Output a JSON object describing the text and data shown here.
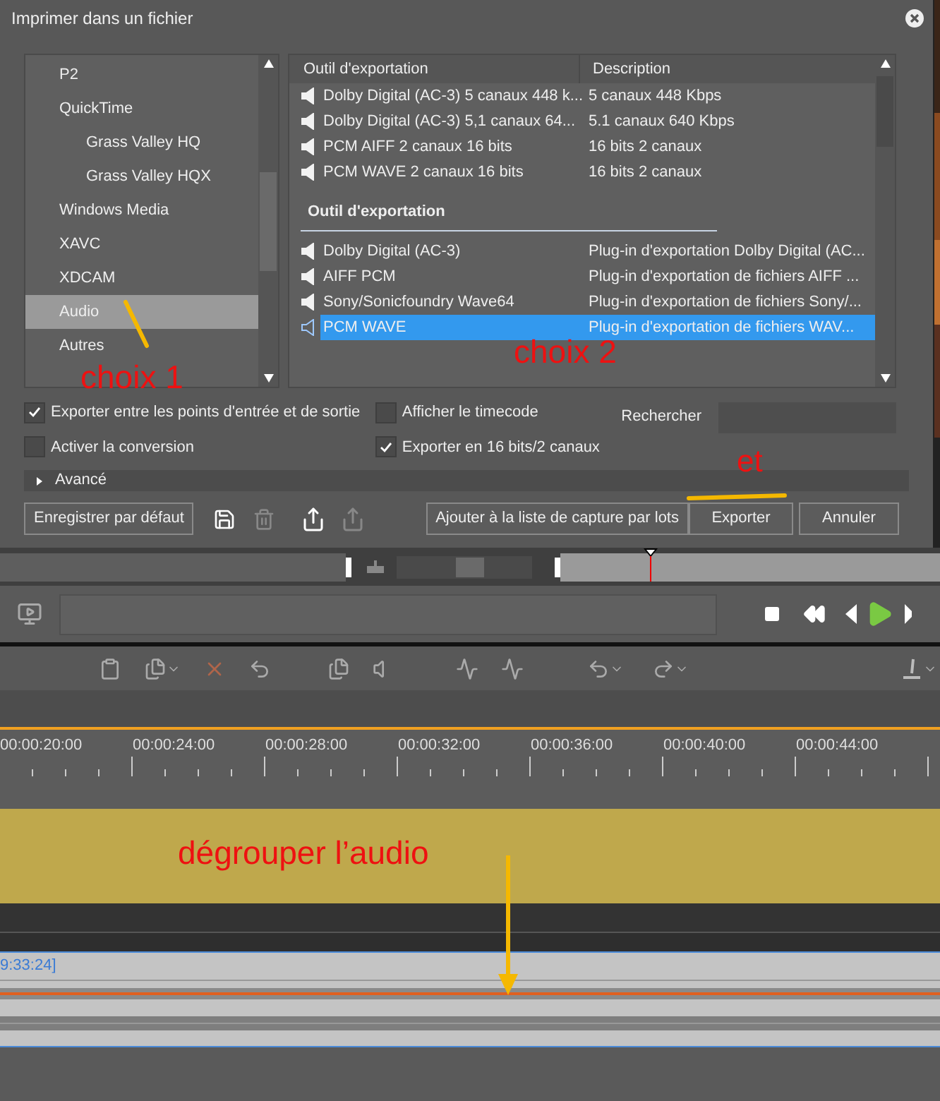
{
  "dialog": {
    "title": "Imprimer dans un fichier",
    "categories": [
      {
        "label": "P2",
        "selected": false
      },
      {
        "label": "QuickTime",
        "selected": false,
        "children": [
          {
            "label": "Grass Valley HQ",
            "selected": false
          },
          {
            "label": "Grass Valley HQX",
            "selected": false
          }
        ]
      },
      {
        "label": "Windows Media",
        "selected": false
      },
      {
        "label": "XAVC",
        "selected": false
      },
      {
        "label": "XDCAM",
        "selected": false
      },
      {
        "label": "Audio",
        "selected": true
      },
      {
        "label": "Autres",
        "selected": false
      }
    ],
    "columns": [
      "Outil d'exportation",
      "Description"
    ],
    "presets": [
      {
        "name": "Dolby Digital (AC-3) 5 canaux 448 k...",
        "description": "5 canaux 448 Kbps",
        "selected": false
      },
      {
        "name": "Dolby Digital (AC-3) 5,1 canaux 64...",
        "description": "5.1 canaux 640 Kbps",
        "selected": false
      },
      {
        "name": "PCM AIFF 2 canaux 16 bits",
        "description": "16 bits 2 canaux",
        "selected": false
      },
      {
        "name": "PCM WAVE 2 canaux 16 bits",
        "description": "16 bits 2 canaux",
        "selected": false
      }
    ],
    "group_header": "Outil d'exportation",
    "exporters": [
      {
        "name": "Dolby Digital (AC-3)",
        "description": "Plug-in d'exportation Dolby Digital (AC...",
        "selected": false
      },
      {
        "name": "AIFF PCM",
        "description": "Plug-in d'exportation de fichiers AIFF ...",
        "selected": false
      },
      {
        "name": "Sony/Sonicfoundry Wave64",
        "description": "Plug-in d'exportation de fichiers Sony/...",
        "selected": false
      },
      {
        "name": "PCM WAVE",
        "description": "Plug-in d'exportation de fichiers WAV...",
        "selected": true
      }
    ],
    "options": [
      {
        "label": "Exporter entre les points d'entrée et de sortie",
        "checked": true
      },
      {
        "label": "Afficher le timecode",
        "checked": false
      },
      {
        "label": "Activer la conversion",
        "checked": false
      },
      {
        "label": "Exporter en 16 bits/2 canaux",
        "checked": true
      }
    ],
    "search": {
      "label": "Rechercher"
    },
    "advanced": {
      "label": "Avancé",
      "expanded": false
    },
    "buttons": {
      "save_default": "Enregistrer par défaut",
      "add_batch": "Ajouter à la liste de capture par lots",
      "export": "Exporter",
      "cancel": "Annuler"
    }
  },
  "timeline": {
    "timecodes": [
      "00:00:20:00",
      "00:00:24:00",
      "00:00:28:00",
      "00:00:32:00",
      "00:00:36:00",
      "00:00:40:00",
      "00:00:44:00"
    ],
    "clip_timecode": "9:33:24]"
  },
  "annotations": [
    {
      "text": "choix 1"
    },
    {
      "text": "choix 2"
    },
    {
      "text": "et"
    },
    {
      "text": "dégrouper l’audio"
    }
  ]
}
